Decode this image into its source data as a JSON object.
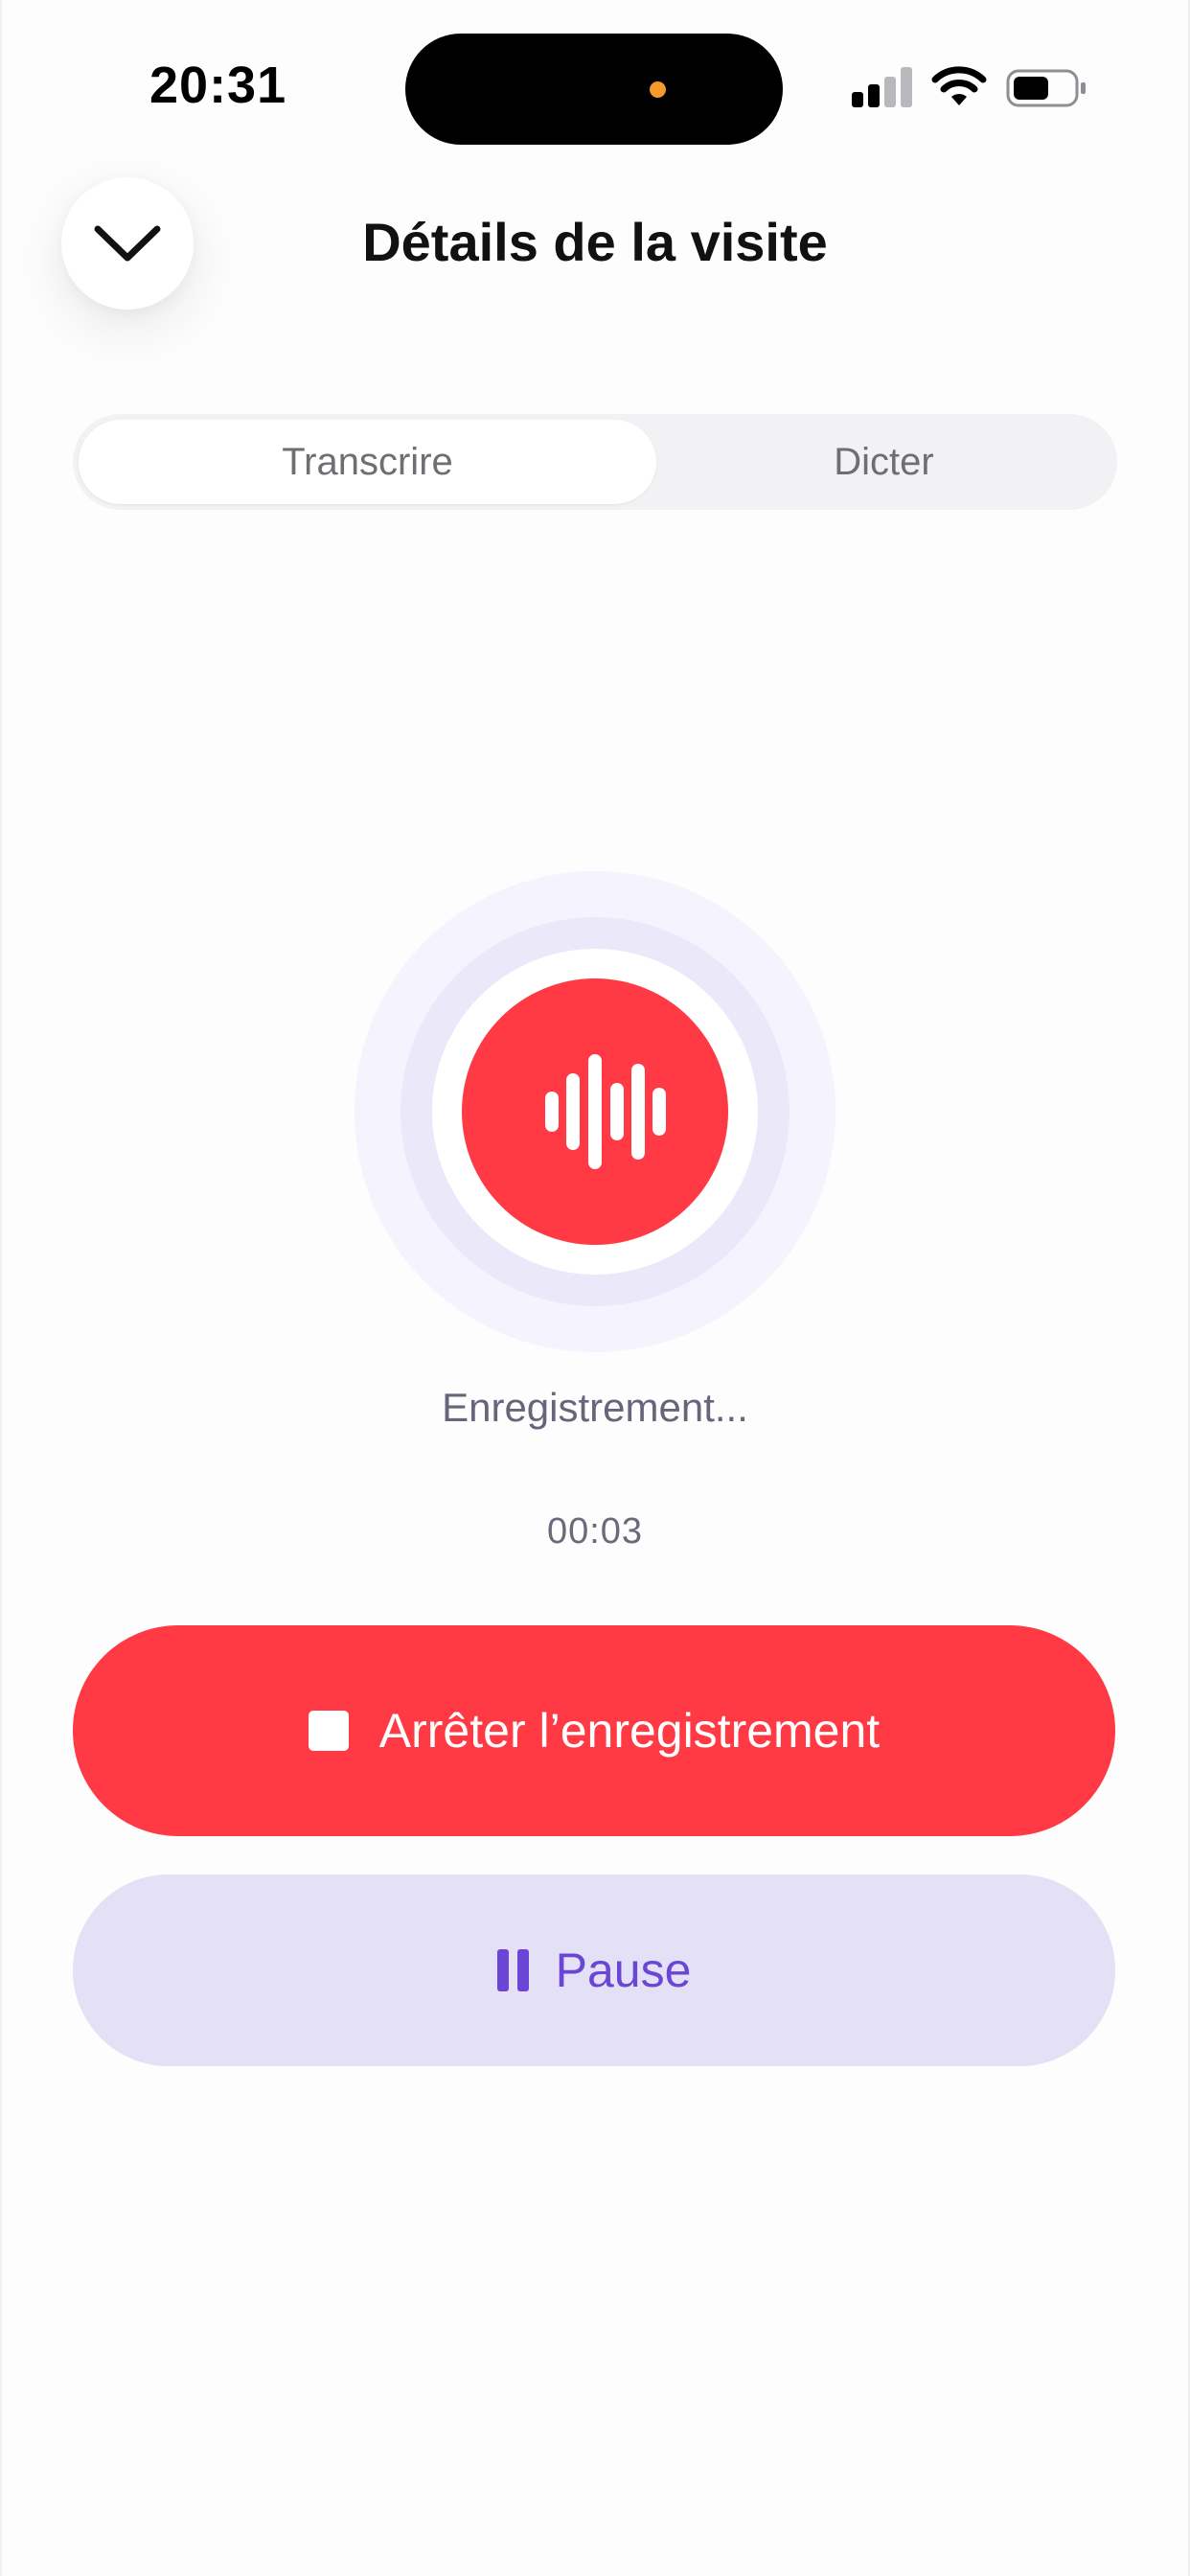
{
  "status_bar": {
    "time": "20:31"
  },
  "header": {
    "title": "Détails de la visite",
    "back_icon": "chevron-down-icon"
  },
  "segments": {
    "items": [
      "Transcrire",
      "Dicter"
    ],
    "selected": "Transcrire"
  },
  "recorder": {
    "icon": "waveform-icon",
    "status": "Enregistrement...",
    "elapsed": "00:03"
  },
  "actions": {
    "stop_label": "Arrêter l’enregistrement",
    "stop_icon": "stop-icon",
    "pause_label": "Pause",
    "pause_icon": "pause-icon"
  },
  "colors": {
    "record_red": "#ff3a44",
    "pause_bg": "#e4e0f6",
    "pause_text": "#6a45d6",
    "ring_light": "#f5f3fd",
    "ring_mid": "#ebe8fa"
  }
}
